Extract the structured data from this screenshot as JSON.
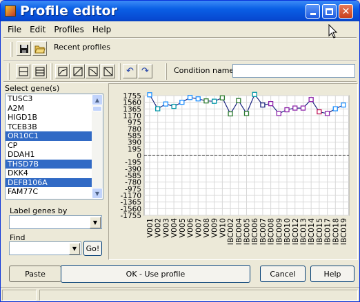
{
  "window": {
    "title": "Profile editor"
  },
  "menu": {
    "file": "File",
    "edit": "Edit",
    "profiles": "Profiles",
    "help": "Help"
  },
  "toolbar": {
    "recent_profiles": "Recent profiles",
    "condition_names_label": "Condition names",
    "condition_names_value": ""
  },
  "left": {
    "select_label": "Select gene(s)",
    "genes": [
      {
        "name": "TUSC3",
        "selected": false
      },
      {
        "name": "A2M",
        "selected": false
      },
      {
        "name": "HIGD1B",
        "selected": false
      },
      {
        "name": "TCEB3B",
        "selected": false
      },
      {
        "name": "OR10C1",
        "selected": true
      },
      {
        "name": "CP",
        "selected": false
      },
      {
        "name": "DDAH1",
        "selected": false
      },
      {
        "name": "THSD7B",
        "selected": true
      },
      {
        "name": "DKK4",
        "selected": false
      },
      {
        "name": "DEFB106A",
        "selected": true
      },
      {
        "name": "FAM77C",
        "selected": false
      }
    ],
    "label_genes_by": "Label genes by",
    "label_genes_value": "",
    "find_label": "Find",
    "find_value": "",
    "go_label": "Go!"
  },
  "buttons": {
    "paste": "Paste",
    "ok": "OK - Use profile",
    "cancel": "Cancel",
    "help": "Help"
  },
  "chart_data": {
    "type": "line",
    "yticks": [
      "1755",
      "1560",
      "1365",
      "1170",
      "975",
      "780",
      "585",
      "390",
      "195",
      "0",
      "-195",
      "-390",
      "-585",
      "-780",
      "-975",
      "-1170",
      "-1365",
      "-1560",
      "-1755"
    ],
    "ylim": [
      -1755,
      1755
    ],
    "categories": [
      "V001",
      "V002",
      "V003",
      "V004",
      "V005",
      "V006",
      "V007",
      "V008",
      "V009",
      "V010",
      "IBC002",
      "IBC004",
      "IBC005",
      "IBC006",
      "IBC007",
      "IBC008",
      "IBC009",
      "IBC010",
      "IBC012",
      "IBC013",
      "IBC014",
      "IBC015",
      "IBC017",
      "IBC018",
      "IBC019"
    ],
    "series": [
      {
        "color": "#1A237E",
        "values": [
          1780,
          1370,
          1510,
          1440,
          1560,
          1700,
          1660,
          1600,
          1590,
          1690,
          1220,
          1610,
          1230,
          1790,
          1480,
          1520,
          1230,
          1340,
          1390,
          1390,
          1640,
          1280,
          1230,
          1370,
          1480
        ]
      }
    ],
    "marker_colors": [
      "#1E90FF",
      "#0097A7",
      "#1E90FF",
      "#0097A7",
      "#1E90FF",
      "#1E90FF",
      "#1E90FF",
      "#2E7D32",
      "#0097A7",
      "#2E7D32",
      "#2E7D32",
      "#2E7D32",
      "#2E7D32",
      "#0097A7",
      "#1A237E",
      "#8E24AA",
      "#8E24AA",
      "#8E24AA",
      "#8E24AA",
      "#8E24AA",
      "#8E24AA",
      "#C2185B",
      "#8E24AA",
      "#1E90FF",
      "#1E90FF"
    ],
    "grid": true,
    "zero_line": "dashed"
  }
}
